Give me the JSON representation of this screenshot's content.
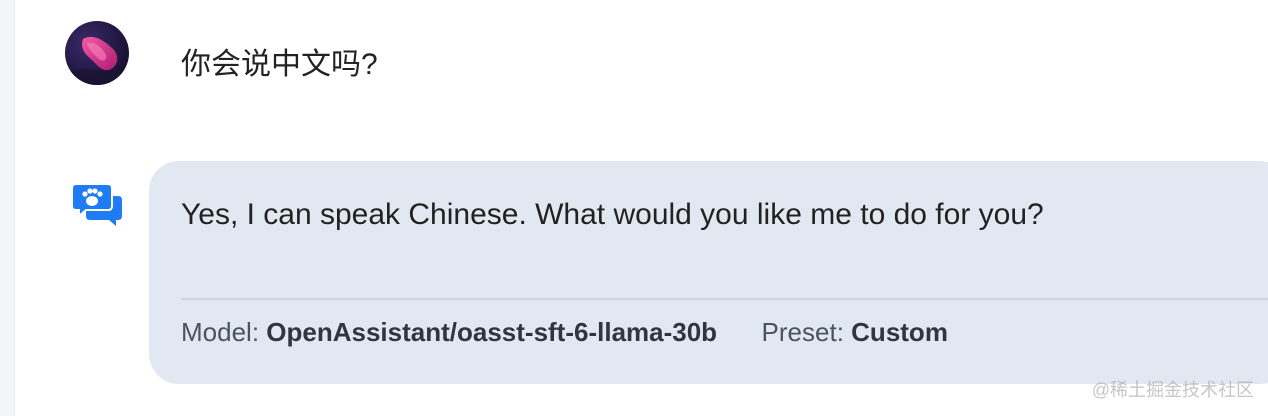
{
  "user_message": {
    "text": "你会说中文吗?"
  },
  "assistant_message": {
    "text": "Yes, I can speak Chinese. What would you like me to do for you?",
    "model_label": "Model:",
    "model_value": "OpenAssistant/oasst-sft-6-llama-30b",
    "preset_label": "Preset:",
    "preset_value": "Custom"
  },
  "watermark": {
    "text": "@稀土掘金技术社区"
  },
  "colors": {
    "card_bg": "#e1e8f1",
    "bot_icon": "#1f7cf2",
    "avatar_dark": "#1b1238",
    "avatar_pink": "#e73b8a"
  },
  "icons": {
    "avatar": "user-avatar",
    "assistant": "chat-paw-icon"
  }
}
